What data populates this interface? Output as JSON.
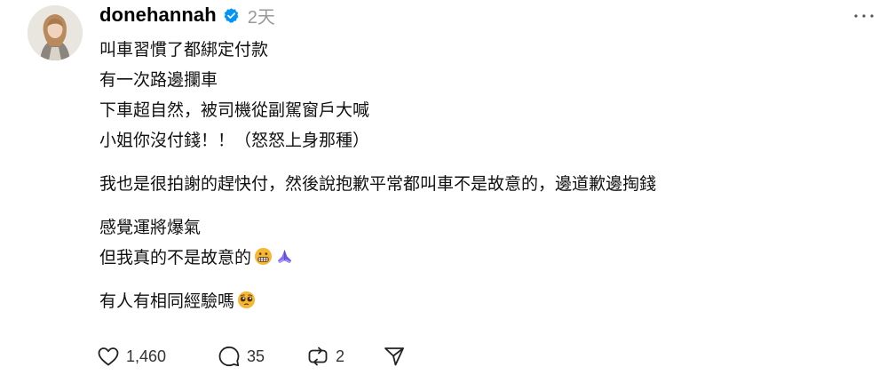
{
  "post": {
    "username": "donehannah",
    "time": "2天",
    "verified": true,
    "paragraphs": [
      {
        "lines": [
          "叫車習慣了都綁定付款",
          "有一次路邊攔車",
          "下車超自然，被司機從副駕窗戶大喊",
          "小姐你沒付錢！！（怒怒上身那種）"
        ]
      },
      {
        "lines": [
          "我也是很拍謝的趕快付，然後說抱歉平常都叫車不是故意的，邊道歉邊掏錢"
        ]
      },
      {
        "lines": [
          "感覺運將爆氣",
          "但我真的不是故意的"
        ]
      },
      {
        "lines": [
          "有人有相同經驗嗎"
        ]
      }
    ],
    "emojis": {
      "line_after_unintentional": [
        "grimacing-face-emoji",
        "folded-hands-emoji"
      ],
      "line_after_question": [
        "pleading-face-emoji"
      ]
    }
  },
  "actions": {
    "likes": "1,460",
    "replies": "35",
    "reposts": "2"
  },
  "colors": {
    "verified_blue": "#0095f6",
    "timestamp_gray": "#999999",
    "icon_dark": "#222222",
    "emoji_yellow": "#f7b733",
    "hands_purple": "#8a6ff0"
  }
}
